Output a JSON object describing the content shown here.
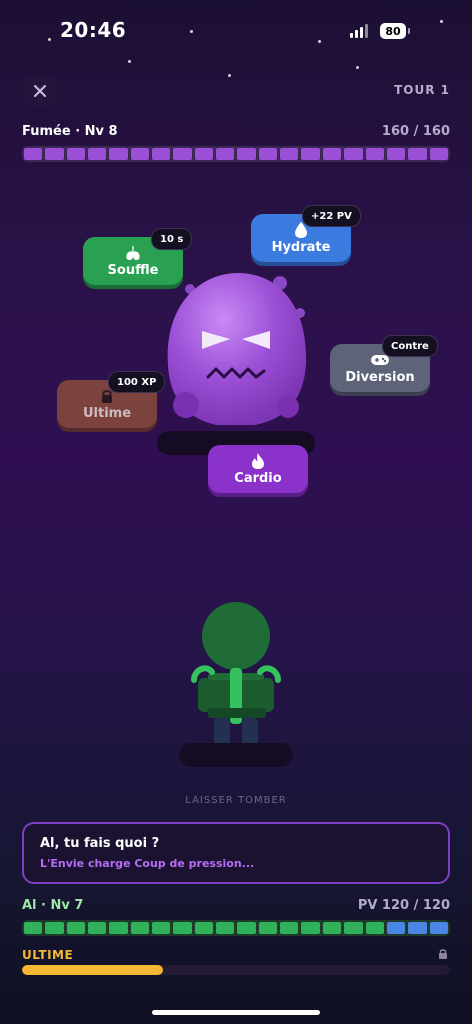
{
  "status_bar": {
    "time": "20:46",
    "battery": "80"
  },
  "header": {
    "round": "TOUR 1"
  },
  "enemy": {
    "name": "Fumée · Nv 8",
    "hp_text": "160 / 160",
    "hp_fraction": 1.0
  },
  "skills": {
    "souffle": {
      "label": "Souffle",
      "badge": "10 s"
    },
    "hydrate": {
      "label": "Hydrate",
      "badge": "+22 PV"
    },
    "diversion": {
      "label": "Diversion",
      "badge": "Contre"
    },
    "ultime": {
      "label": "Ultime",
      "badge": "100 XP"
    },
    "cardio": {
      "label": "Cardio"
    }
  },
  "drop_label": "LAISSER TOMBER",
  "message": {
    "title": "Al, tu fais quoi ?",
    "subtitle": "L'Envie charge Coup de pression..."
  },
  "player": {
    "name": "Al · Nv 7",
    "hp_text": "PV 120 / 120",
    "hp_fraction": 1.0,
    "shield_fraction": 0.17
  },
  "ultimate": {
    "label": "ULTIME",
    "fraction": 0.33
  },
  "colors": {
    "enemy": "#9b4fd6",
    "player": "#2fb25a",
    "shield": "#4a86e8",
    "ultimate": "#f5b734"
  }
}
